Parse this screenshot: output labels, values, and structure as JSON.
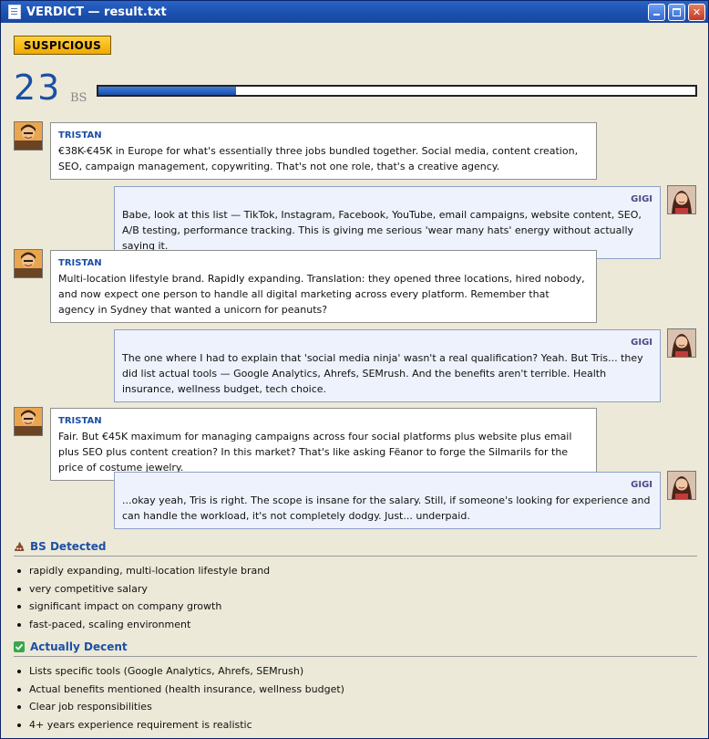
{
  "window": {
    "title": "VERDICT — result.txt"
  },
  "verdict": {
    "badge": "SUSPICIOUS",
    "score": "23",
    "unit": "BS",
    "meter_fraction": 0.23
  },
  "conversation": [
    {
      "speaker": "TRISTAN",
      "side": "left",
      "text": "€38K-€45K in Europe for what's essentially three jobs bundled together. Social media, content creation, SEO, campaign management, copywriting. That's not one role, that's a creative agency."
    },
    {
      "speaker": "GIGI",
      "side": "right",
      "text": "Babe, look at this list — TikTok, Instagram, Facebook, YouTube, email campaigns, website content, SEO, A/B testing, performance tracking. This is giving me serious 'wear many hats' energy without actually saying it."
    },
    {
      "speaker": "TRISTAN",
      "side": "left",
      "text": "Multi-location lifestyle brand. Rapidly expanding. Translation: they opened three locations, hired nobody, and now expect one person to handle all digital marketing across every platform. Remember that agency in Sydney that wanted a unicorn for peanuts?"
    },
    {
      "speaker": "GIGI",
      "side": "right",
      "text": "The one where I had to explain that 'social media ninja' wasn't a real qualification? Yeah. But Tris... they did list actual tools — Google Analytics, Ahrefs, SEMrush. And the benefits aren't terrible. Health insurance, wellness budget, tech choice."
    },
    {
      "speaker": "TRISTAN",
      "side": "left",
      "text": "Fair. But €45K maximum for managing campaigns across four social platforms plus website plus email plus SEO plus content creation? In this market? That's like asking Fëanor to forge the Silmarils for the price of costume jewelry."
    },
    {
      "speaker": "GIGI",
      "side": "right",
      "text": "...okay yeah, Tris is right. The scope is insane for the salary. Still, if someone's looking for experience and can handle the workload, it's not completely dodgy. Just... underpaid."
    }
  ],
  "bs_detected": {
    "title": "BS Detected",
    "icon": "poop-icon",
    "items": [
      "rapidly expanding, multi-location lifestyle brand",
      "very competitive salary",
      "significant impact on company growth",
      "fast-paced, scaling environment"
    ]
  },
  "actually_decent": {
    "title": "Actually Decent",
    "icon": "check-icon",
    "items": [
      "Lists specific tools (Google Analytics, Ahrefs, SEMrush)",
      "Actual benefits mentioned (health insurance, wellness budget)",
      "Clear job responsibilities",
      "4+ years experience requirement is realistic"
    ]
  }
}
